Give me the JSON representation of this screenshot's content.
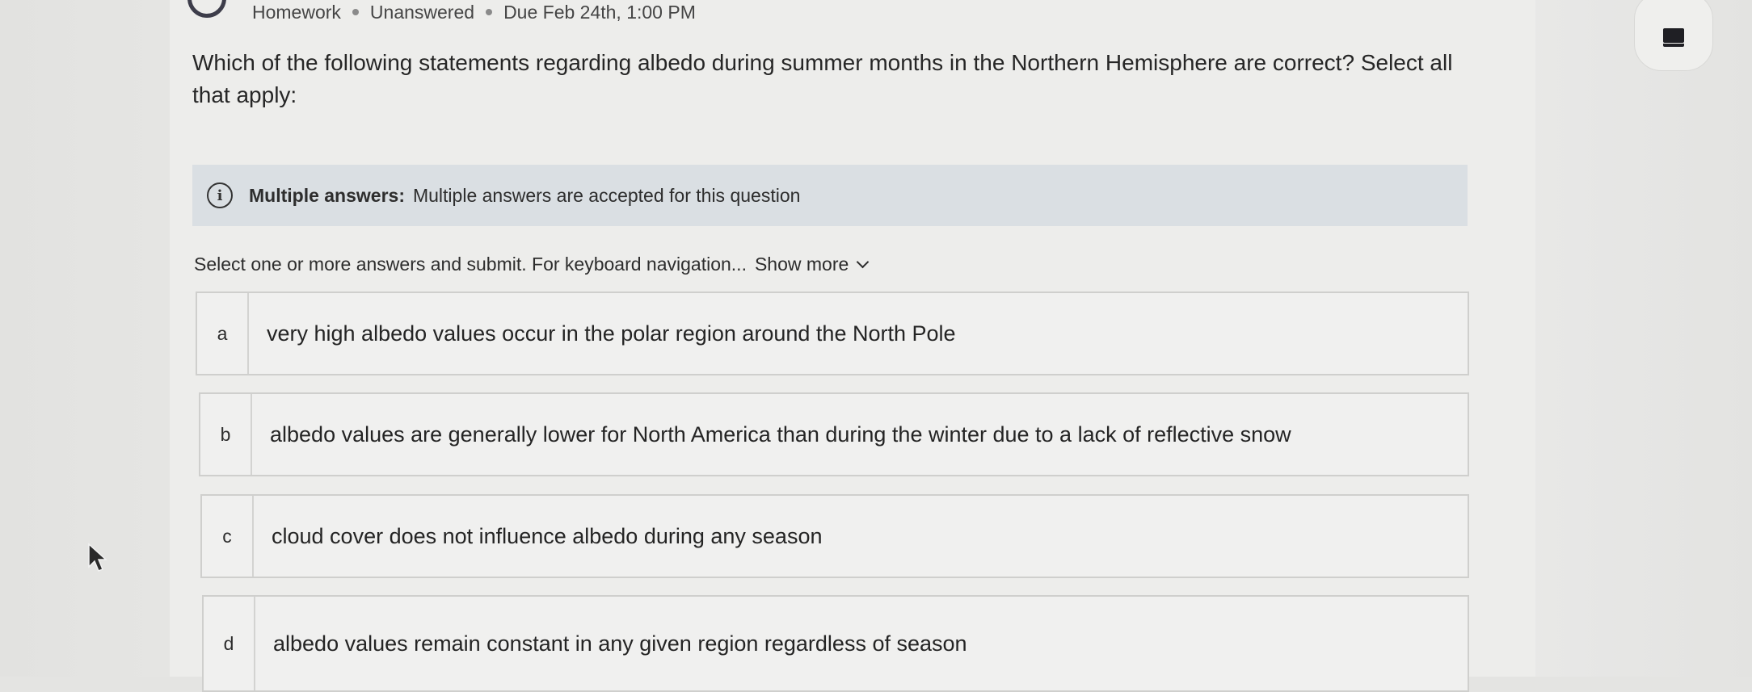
{
  "header": {
    "category": "Homework",
    "status": "Unanswered",
    "due": "Due Feb 24th, 1:00 PM"
  },
  "question": {
    "text": "Which of the following statements regarding albedo during summer months in the Northern Hemisphere are correct? Select all that apply:"
  },
  "info_banner": {
    "icon": "info-icon",
    "title": "Multiple answers:",
    "message": "Multiple answers are accepted for this question"
  },
  "instructions": {
    "text": "Select one or more answers and submit. For keyboard navigation...",
    "show_more_label": "Show more"
  },
  "options": [
    {
      "letter": "a",
      "text": "very high albedo values occur in the polar region around the North Pole"
    },
    {
      "letter": "b",
      "text": "albedo values are generally lower for North America than during the winter due to a lack of reflective snow"
    },
    {
      "letter": "c",
      "text": "cloud cover does not influence albedo during any season"
    },
    {
      "letter": "d",
      "text": "albedo values remain constant in any given region regardless of season"
    }
  ],
  "icons": {
    "avatar": "avatar-icon",
    "corner_widget": "notebook-icon",
    "cursor": "mouse-cursor-icon"
  }
}
